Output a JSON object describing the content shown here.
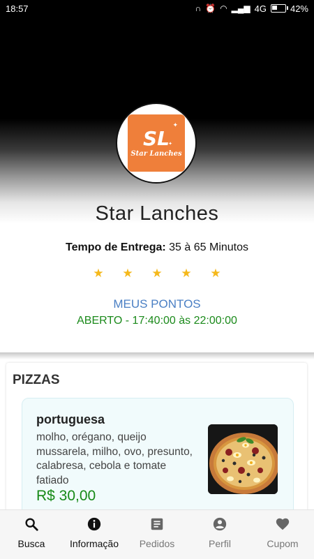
{
  "status_bar": {
    "time": "18:57",
    "network": "4G",
    "battery": "42%",
    "battery_level": 0.42
  },
  "store": {
    "logo_mark": "SL",
    "logo_text": "Star Lanches",
    "name": "Star Lanches",
    "delivery_label": "Tempo de Entrega:",
    "delivery_value": "35 à 65 Minutos",
    "rating": 5,
    "points_link": "MEUS PONTOS",
    "hours": "ABERTO - 17:40:00 às 22:00:00"
  },
  "colors": {
    "accent": "#4a7fc4",
    "open": "#1b8a1b",
    "star": "#f5b81a",
    "logo_bg": "#ef7f3a"
  },
  "menu": {
    "section_title": "PIZZAS",
    "items": [
      {
        "name": "portuguesa",
        "description": "molho, orégano, queijo mussarela, milho, ovo, presunto, calabresa, cebola e tomate fatiado",
        "price": "R$ 30,00"
      }
    ]
  },
  "bottom_nav": [
    {
      "label": "Busca",
      "icon": "search-icon",
      "active": true
    },
    {
      "label": "Informação",
      "icon": "info-icon",
      "active": true
    },
    {
      "label": "Pedidos",
      "icon": "receipt-icon",
      "active": false
    },
    {
      "label": "Perfil",
      "icon": "account-icon",
      "active": false
    },
    {
      "label": "Cupom",
      "icon": "heart-icon",
      "active": false
    }
  ]
}
